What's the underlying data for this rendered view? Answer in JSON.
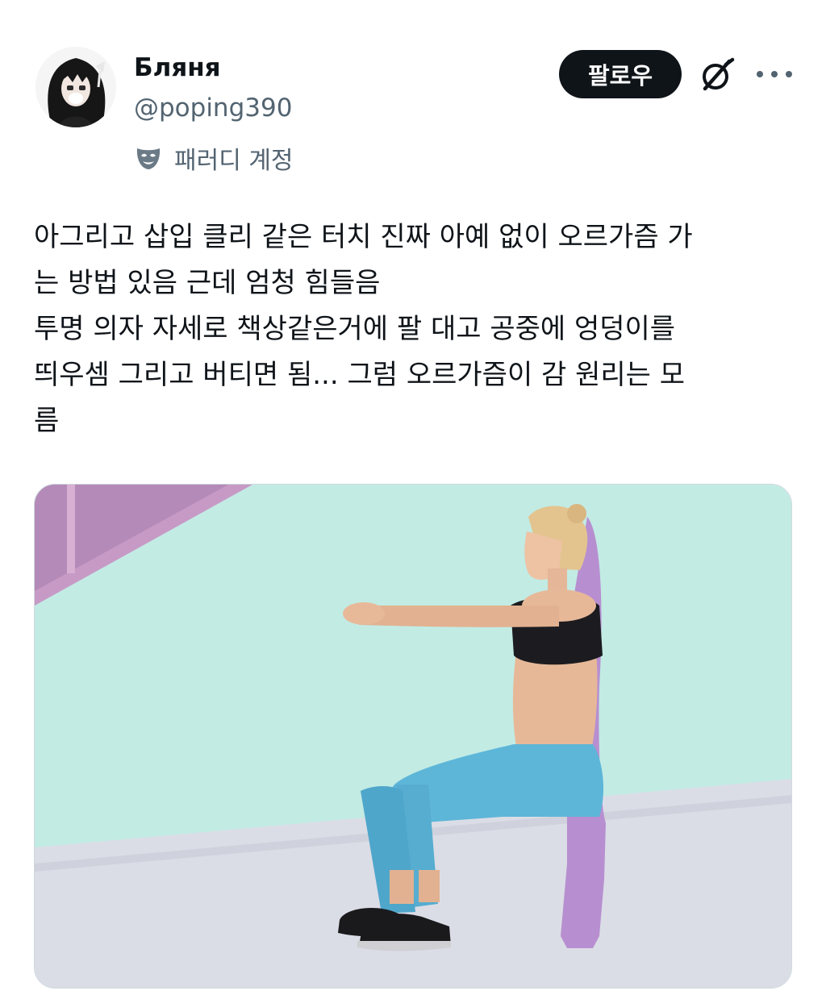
{
  "author": {
    "display_name": "Бляня",
    "handle": "@poping390",
    "account_label": "패러디 계정",
    "avatar_icon": "anime-girl-avatar",
    "label_icon": "parody-mask-icon"
  },
  "actions": {
    "follow_label": "팔로우",
    "grok_icon": "grok-icon",
    "more_icon": "more-dots-icon"
  },
  "tweet": {
    "lines": [
      "아그리고 삽입 클리 같은 터치 진짜 아예 없이 오르가즘 가",
      "는 방법 있음 근데 엄청 힘들음",
      "투명 의자 자세로 책상같은거에 팔 대고 공중에 엉덩이를",
      "띄우셈 그리고 버티면 됨... 그럼 오르가즘이 감 원리는 모",
      "름"
    ]
  },
  "media": {
    "type": "photo",
    "colors": {
      "wall": "#bfe9e3",
      "ground": "#dcdde6",
      "shadow": "#b98bd0",
      "leggings": "#5cb6d8",
      "top": "#1b1b1e",
      "skin": "#e8b89a",
      "hair": "#e2c28e"
    }
  }
}
